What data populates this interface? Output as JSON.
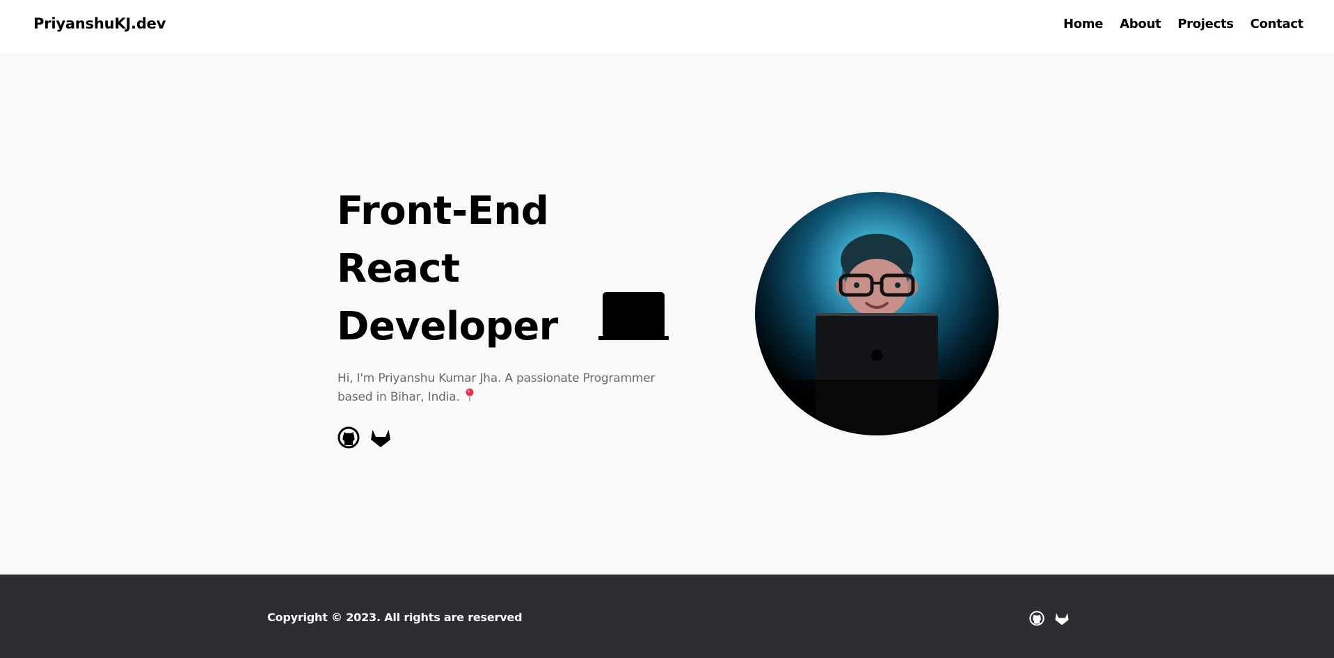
{
  "header": {
    "brand": "PriyanshuKJ.dev",
    "nav": [
      {
        "label": "Home"
      },
      {
        "label": "About"
      },
      {
        "label": "Projects"
      },
      {
        "label": "Contact"
      }
    ]
  },
  "hero": {
    "title_lines": [
      "Front-End",
      "React",
      "Developer"
    ],
    "laptop_icon": "laptop-icon",
    "subtitle_line1": "Hi, I'm Priyanshu Kumar Jha. A passionate Programmer",
    "subtitle_line2": "based in Bihar, India.",
    "pin_icon": "map-pin-icon",
    "social_icons": [
      "github-icon",
      "gitlab-icon"
    ],
    "avatar": "memoji-avatar"
  },
  "footer": {
    "copyright": "Copyright © 2023. All rights are reserved",
    "social_icons": [
      "github-icon",
      "gitlab-icon"
    ]
  },
  "colors": {
    "footer_bg": "#2d2e32",
    "hero_bg": "#f9f9f9",
    "subtitle_text": "#6b6b6b",
    "pin": "#e0364a"
  }
}
